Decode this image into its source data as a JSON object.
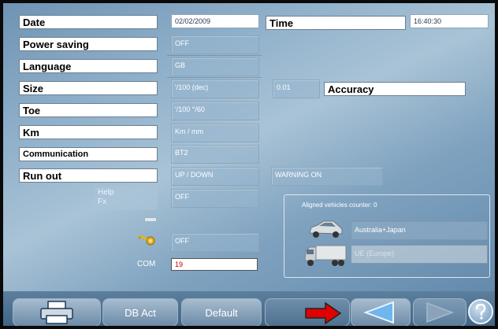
{
  "settings": [
    {
      "label": "Date",
      "value": "02/02/2009"
    },
    {
      "label": "Power saving",
      "value": "OFF"
    },
    {
      "label": "Language",
      "value": "GB"
    },
    {
      "label": "Size",
      "value": "'/100 (dec)"
    },
    {
      "label": "Toe",
      "value": "'/100  °/60"
    },
    {
      "label": "Km",
      "value": "Km / mm"
    },
    {
      "label": "Communication",
      "value": "BT2"
    },
    {
      "label": "Run out",
      "value": "UP / DOWN"
    }
  ],
  "time": {
    "label": "Time",
    "value": "16:40:30"
  },
  "accuracy": {
    "label": "Accuracy",
    "value": "0.01"
  },
  "warning": "WARNING ON",
  "help": {
    "label": "Help\nFx",
    "value": "OFF"
  },
  "key_value": "OFF",
  "com": {
    "label": "COM",
    "value": "19"
  },
  "counter_label": "Aligned vehicles counter:  0",
  "regions": [
    "Australia+Japan",
    "UE (Europe)"
  ],
  "toolbar": {
    "db_act": "DB Act",
    "default": "Default"
  },
  "colors": {
    "accent_red": "#e00000",
    "arrow_blue": "#6fb6ee"
  }
}
